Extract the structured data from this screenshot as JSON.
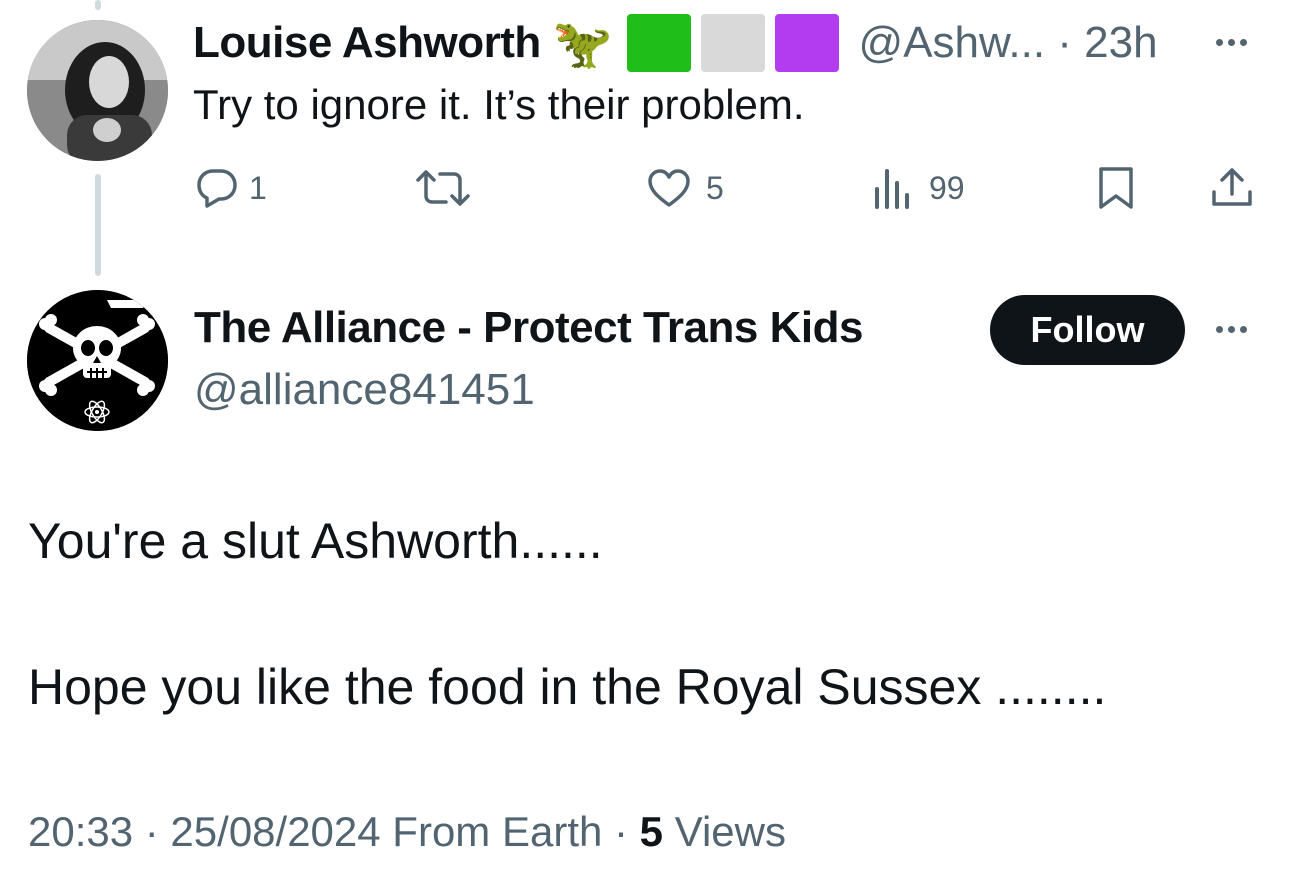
{
  "reply": {
    "display_name": "Louise Ashworth",
    "dino_emoji": "🦖",
    "flag_colors": [
      "#1fbe18",
      "#d9d9d9",
      "#b43cf0"
    ],
    "handle_time": "@Ashw... · 23h",
    "text": "Try to ignore it. It’s their problem.",
    "replies": "1",
    "retweets": "",
    "likes": "5",
    "views": "99"
  },
  "main": {
    "display_name": "The Alliance - Protect Trans Kids",
    "handle": "@alliance841451",
    "follow_label": "Follow",
    "line1": "You're a slut Ashworth......",
    "line2": "Hope you like the food in the Royal Sussex ........",
    "timestamp": "20:33 · 25/08/2024 From Earth · ",
    "views_count": "5",
    "views_label": " Views"
  },
  "icons": {
    "reply": "reply-icon",
    "retweet": "retweet-icon",
    "like": "heart-icon",
    "views": "views-icon",
    "bookmark": "bookmark-icon",
    "share": "share-icon",
    "more": "more-icon"
  }
}
